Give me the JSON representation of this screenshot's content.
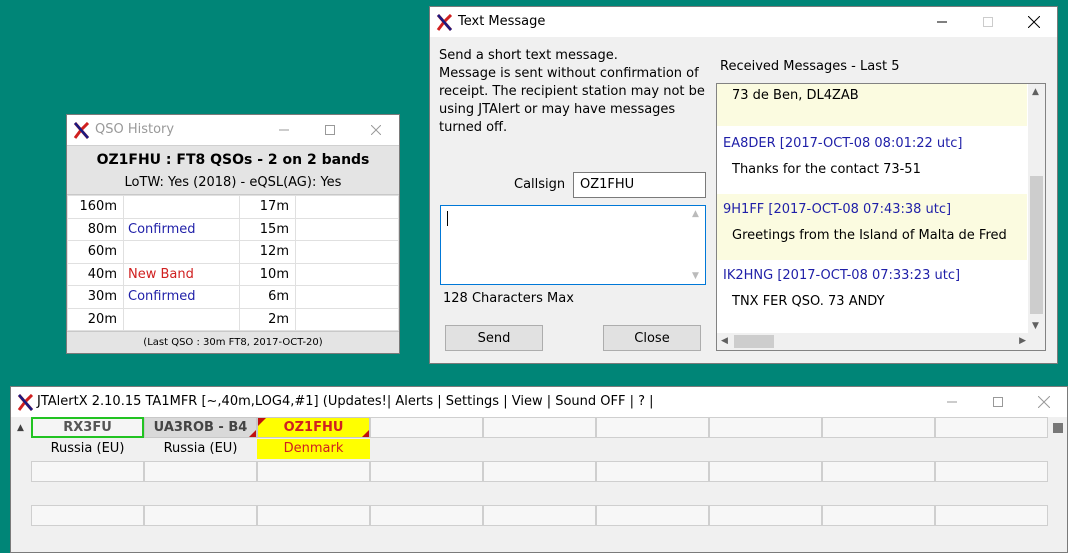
{
  "qso_history": {
    "title": "QSO History",
    "header": "OZ1FHU : FT8 QSOs - 2 on 2 bands",
    "subheader": "LoTW: Yes (2018) - eQSL(AG): Yes",
    "rows": [
      {
        "band": "160m",
        "status": "",
        "band2": "17m",
        "status2": ""
      },
      {
        "band": "80m",
        "status": "Confirmed",
        "band2": "15m",
        "status2": ""
      },
      {
        "band": "60m",
        "status": "",
        "band2": "12m",
        "status2": ""
      },
      {
        "band": "40m",
        "status": "New Band",
        "band2": "10m",
        "status2": ""
      },
      {
        "band": "30m",
        "status": "Confirmed",
        "band2": "6m",
        "status2": ""
      },
      {
        "band": "20m",
        "status": "",
        "band2": "2m",
        "status2": ""
      }
    ],
    "footer": "(Last QSO : 30m FT8, 2017-OCT-20)"
  },
  "text_message": {
    "title": "Text Message",
    "info_lines": [
      "Send a short text message.",
      "Message is sent without confirmation of",
      "receipt. The recipient station may not be",
      "using JTAlert or may have messages",
      "turned off."
    ],
    "callsign_label": "Callsign",
    "callsign_value": "OZ1FHU",
    "max_label": "128 Characters Max",
    "send_label": "Send",
    "close_label": "Close",
    "received_label": "Received Messages - Last 5",
    "top_partial": "73 de Ben, DL4ZAB",
    "messages": [
      {
        "header": "EA8DER [2017-OCT-08 08:01:22 utc]",
        "body": "Thanks for the contact 73-51"
      },
      {
        "header": "9H1FF [2017-OCT-08 07:43:38 utc]",
        "body": "Greetings from the Island of Malta de Fred"
      },
      {
        "header": "IK2HNG [2017-OCT-08 07:33:23 utc]",
        "body": "TNX FER QSO. 73 ANDY"
      }
    ]
  },
  "jtalert": {
    "title": "JTAlertX 2.10.15 TA1MFR [~,40m,LOG4,#1] (Updates!| Alerts | Settings | View | Sound OFF | ? |",
    "stations": [
      {
        "call": "RX3FU",
        "country": "Russia (EU)"
      },
      {
        "call": "UA3ROB - B4",
        "country": "Russia (EU)"
      },
      {
        "call": "OZ1FHU",
        "country": "Denmark"
      }
    ]
  },
  "colors": {
    "desktop": "#008577",
    "confirmed": "#1f1fa8",
    "new_band": "#d02020",
    "highlight_yellow": "#ffff00",
    "rx_border": "#22c322"
  }
}
